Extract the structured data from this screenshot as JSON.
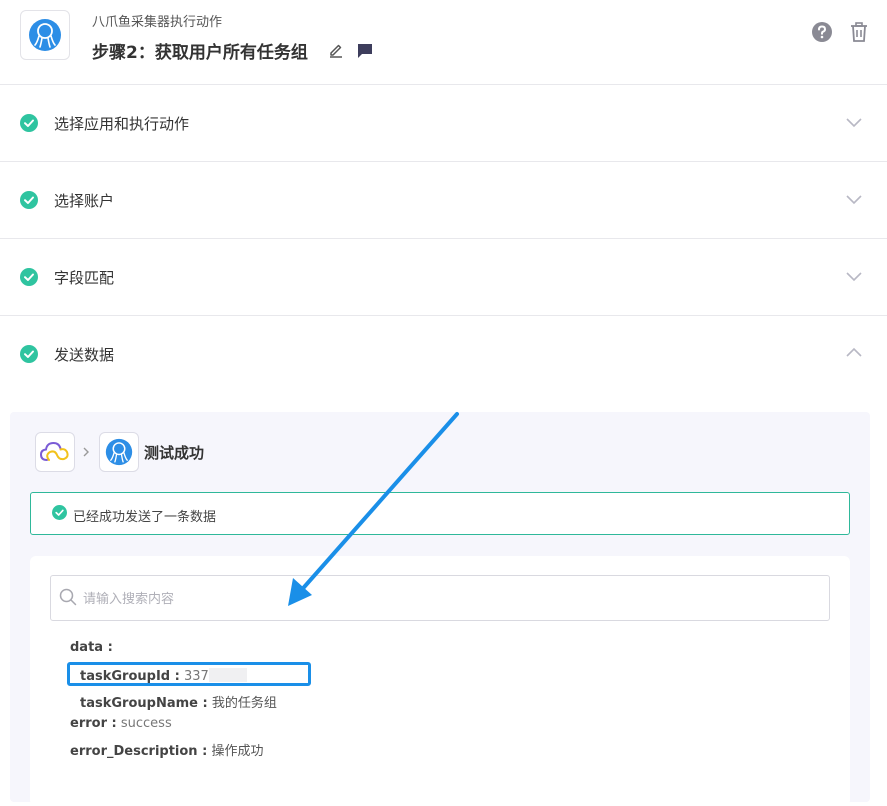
{
  "header": {
    "app_name": "八爪鱼采集器执行动作",
    "step_title": "步骤2：获取用户所有任务组"
  },
  "sections": [
    {
      "label": "选择应用和执行动作",
      "state": "collapsed",
      "status": "complete"
    },
    {
      "label": "选择账户",
      "state": "collapsed",
      "status": "complete"
    },
    {
      "label": "字段匹配",
      "state": "collapsed",
      "status": "complete"
    },
    {
      "label": "发送数据",
      "state": "expanded",
      "status": "complete"
    }
  ],
  "test": {
    "title": "测试成功",
    "success_message": "已经成功发送了一条数据"
  },
  "search": {
    "placeholder": "请输入搜索内容",
    "value": ""
  },
  "result": {
    "data_key": "data :",
    "fields": [
      {
        "key": "taskGroupId :",
        "value": "337",
        "masked": true,
        "highlighted": true
      },
      {
        "key": "taskGroupName :",
        "value": "我的任务组"
      },
      {
        "key": "error :",
        "value": "success"
      },
      {
        "key": "error_Description :",
        "value": "操作成功"
      }
    ]
  },
  "colors": {
    "success": "#2fc4a0",
    "highlight": "#1a8fe8",
    "panel_bg": "#f6f6fc"
  },
  "icons": [
    "octopus-logo-icon",
    "edit-icon",
    "comment-icon",
    "help-icon",
    "trash-icon",
    "check-circle-icon",
    "chevron-down-icon",
    "chevron-up-icon",
    "cloud-logo-icon",
    "search-icon"
  ]
}
